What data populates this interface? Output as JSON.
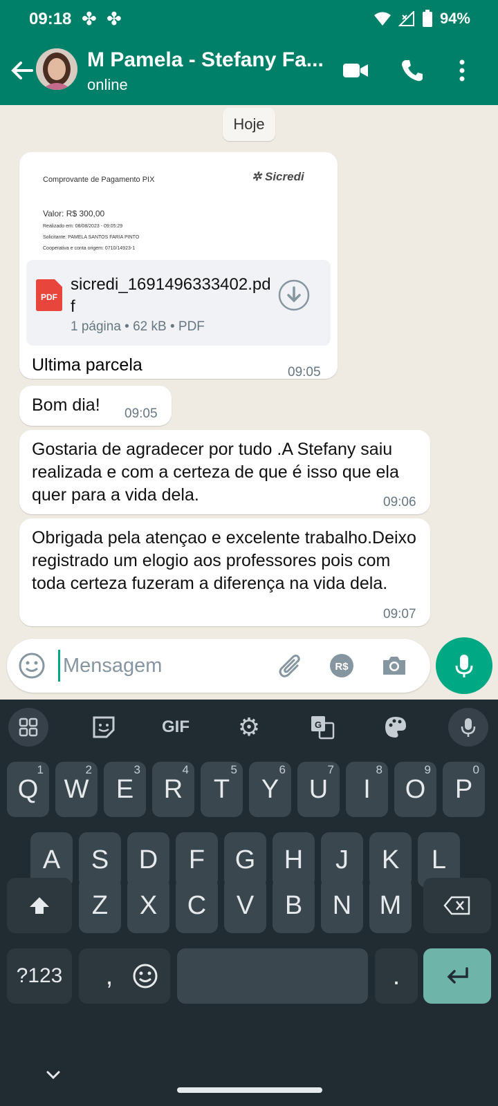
{
  "status_bar": {
    "time": "09:18",
    "battery": "94%"
  },
  "header": {
    "contact_name": "M Pamela - Stefany Fa...",
    "status": "online"
  },
  "chat": {
    "date_chip": "Hoje",
    "document": {
      "preview": {
        "title": "Comprovante de Pagamento PIX",
        "bank": "Sicredi",
        "value": "Valor: R$ 300,00",
        "line1": "Realizado em: 08/08/2023 - 09:05:29",
        "line2": "Solicitante: PAMELA SANTOS FARIA PINTO",
        "line3": "Cooperativa e conta origem: 0710/14923-1"
      },
      "pdf_label": "PDF",
      "file_name": "sicredi_1691496333402.pdf",
      "file_meta": "1 página • 62 kB • PDF",
      "caption": "Ultima parcela",
      "time": "09:05"
    },
    "messages": [
      {
        "text": "Bom dia!",
        "time": "09:05"
      },
      {
        "text": "Gostaria de agradecer por tudo .A Stefany saiu realizada e com a certeza de que é isso que ela quer para a vida dela.",
        "time": "09:06"
      },
      {
        "text": "Obrigada pela atençao e excelente trabalho.Deixo registrado um elogio aos professores pois com toda certeza fuzeram a diferença na vida dela.",
        "time": "09:07"
      }
    ]
  },
  "input": {
    "placeholder": "Mensagem",
    "currency_label": "R$"
  },
  "keyboard": {
    "toolbar_gif": "GIF",
    "row1": [
      {
        "key": "Q",
        "hint": "1"
      },
      {
        "key": "W",
        "hint": "2"
      },
      {
        "key": "E",
        "hint": "3"
      },
      {
        "key": "R",
        "hint": "4"
      },
      {
        "key": "T",
        "hint": "5"
      },
      {
        "key": "Y",
        "hint": "6"
      },
      {
        "key": "U",
        "hint": "7"
      },
      {
        "key": "I",
        "hint": "8"
      },
      {
        "key": "O",
        "hint": "9"
      },
      {
        "key": "P",
        "hint": "0"
      }
    ],
    "row2": [
      "A",
      "S",
      "D",
      "F",
      "G",
      "H",
      "J",
      "K",
      "L"
    ],
    "row3": [
      "Z",
      "X",
      "C",
      "V",
      "B",
      "N",
      "M"
    ],
    "symbols_label": "?123",
    "comma": ",",
    "period": "."
  },
  "colors": {
    "primary": "#008069",
    "accent": "#00a884",
    "chat_bg": "#efeae2",
    "keyboard_bg": "#202b32"
  }
}
